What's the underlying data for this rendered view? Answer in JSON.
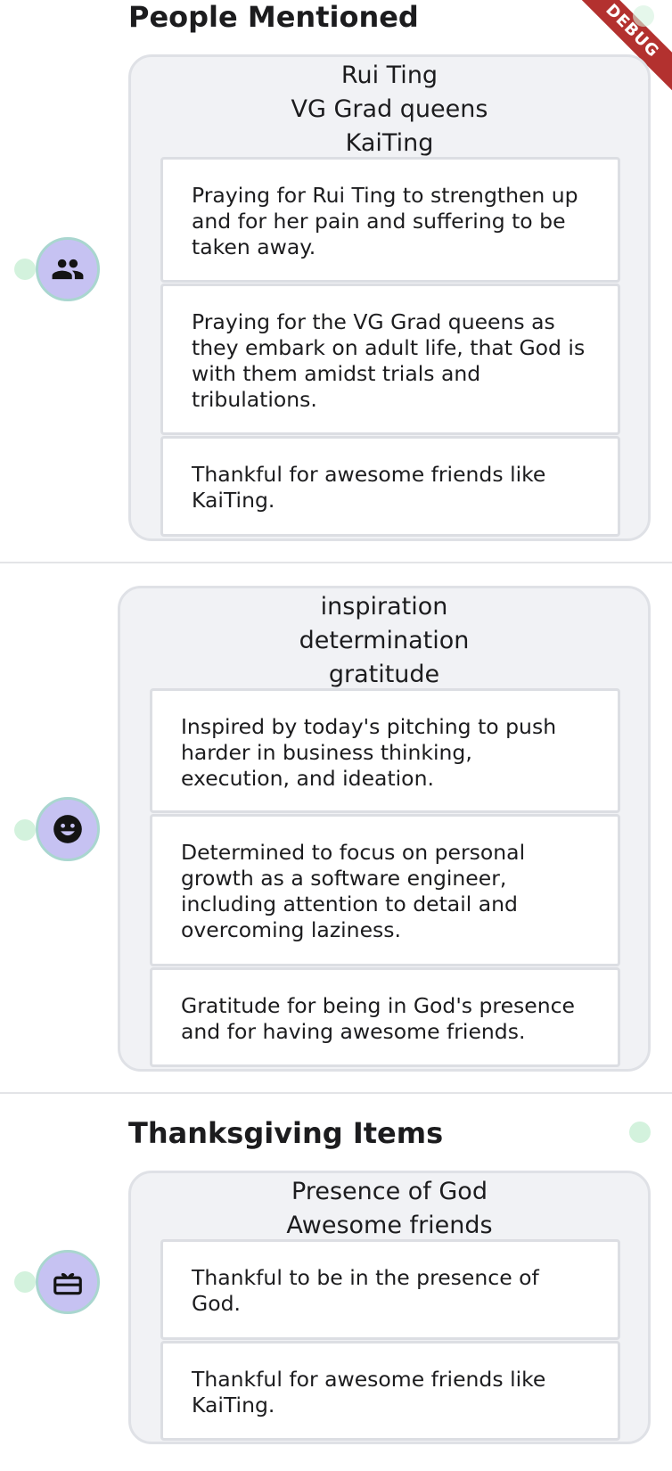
{
  "debug_banner": "DEBUG",
  "sections": [
    {
      "title": "People Mentioned",
      "icon": "people-icon",
      "tags": [
        "Rui Ting",
        "VG Grad queens",
        "KaiTing"
      ],
      "items": [
        "Praying for Rui Ting to strengthen up\nand for her pain and suffering to be\ntaken away.",
        "Praying for the VG Grad queens as\nthey embark on adult life, that God is\nwith them amidst trials and\ntribulations.",
        "Thankful for awesome friends like\nKaiTing."
      ]
    },
    {
      "title": "",
      "icon": "smiley-face-icon",
      "tags": [
        "inspiration",
        "determination",
        "gratitude"
      ],
      "items": [
        "Inspired by today's pitching to push\nharder in business thinking,\nexecution, and ideation.",
        "Determined to focus on personal\ngrowth as a software engineer,\nincluding attention to detail and\novercoming laziness.",
        "Gratitude for being in God's presence\nand for having awesome friends."
      ]
    },
    {
      "title": "Thanksgiving Items",
      "icon": "gift-icon",
      "tags": [
        "Presence of God",
        "Awesome friends"
      ],
      "items": [
        "Thankful to be in the presence of\nGod.",
        "Thankful for awesome friends like\nKaiTing."
      ]
    }
  ],
  "colors": {
    "avatar_bg": "#c6c2f2",
    "avatar_border": "#a9d6cf",
    "dot": "#d3f2dd",
    "card_bg": "#f1f2f5",
    "debug": "#b3312f"
  }
}
